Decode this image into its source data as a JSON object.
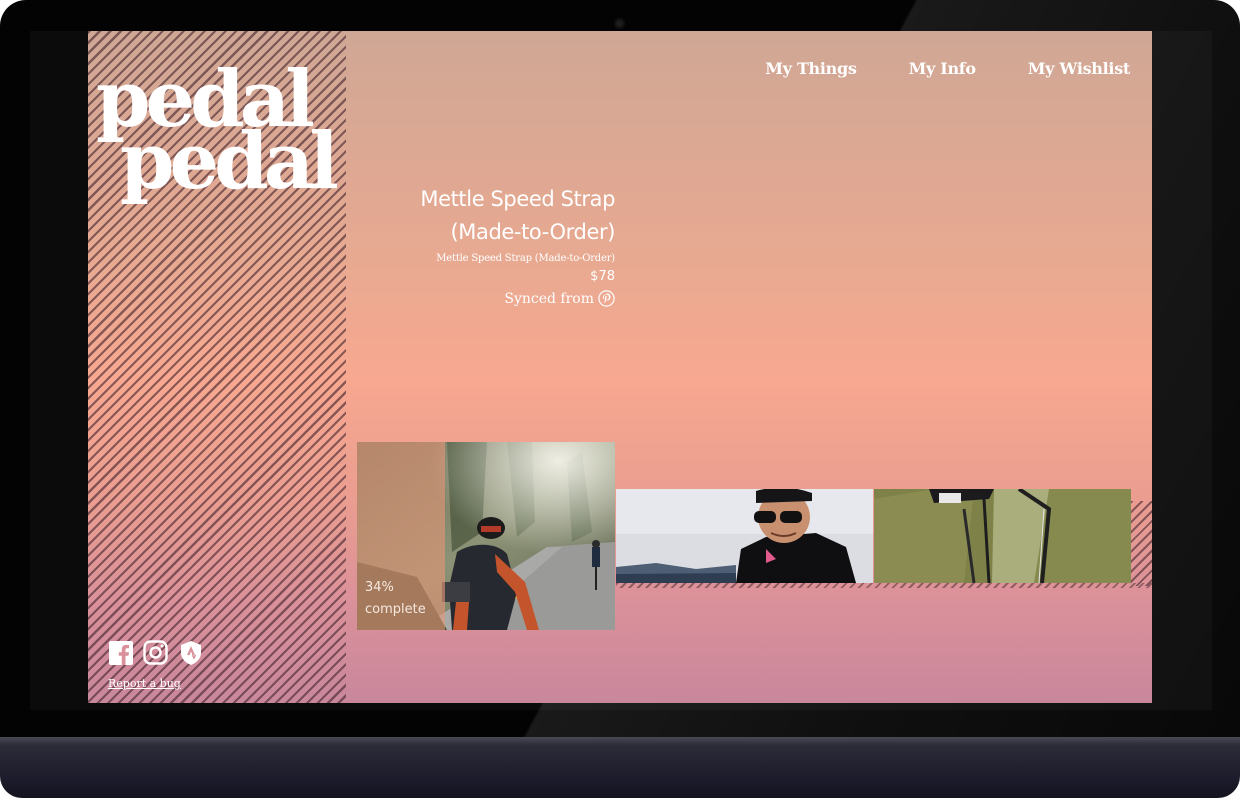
{
  "brand": {
    "logo_line1": "pedal",
    "logo_line2": "pedal"
  },
  "nav": {
    "items": [
      "My Things",
      "My Info",
      "My Wishlist"
    ]
  },
  "product": {
    "title": "Mettle Speed Strap (Made-to-Order)",
    "subtitle": "Mettle Speed Strap (Made-to-Order)",
    "price": "$78",
    "synced_label": "Synced from",
    "synced_icon": "pinterest-icon"
  },
  "progress": {
    "percent_label": "34%",
    "status_label": "complete",
    "value": 0.34
  },
  "footer": {
    "social_icons": [
      "facebook-icon",
      "instagram-icon",
      "strava-icon"
    ],
    "report_bug_label": "Report a bug"
  },
  "colors": {
    "text": "#ffffff",
    "gradient_top": "#cfa795",
    "gradient_mid": "#f8a890",
    "gradient_bottom": "#c9879c",
    "hatch": "#462630"
  }
}
